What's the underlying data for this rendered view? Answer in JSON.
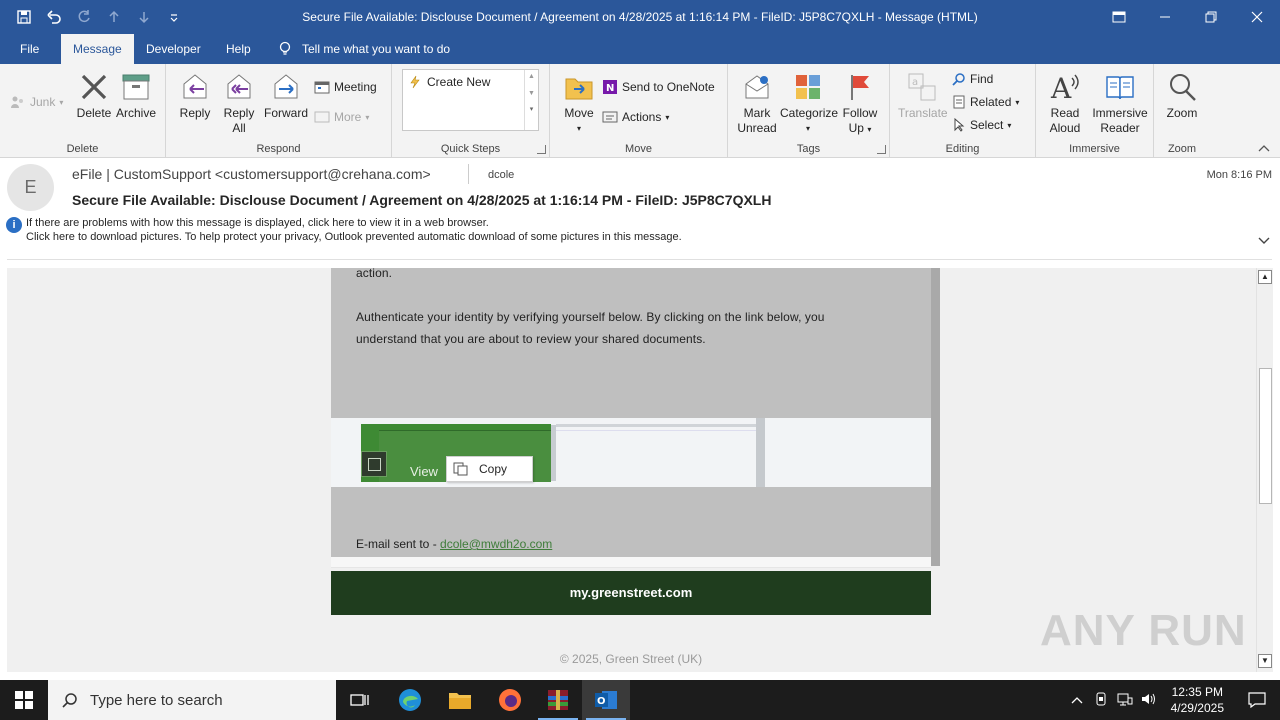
{
  "window": {
    "title": "Secure File Available: Disclouse Document / Agreement on 4/28/2025 at 1:16:14 PM - FileID: J5P8C7QXLH  -  Message (HTML)"
  },
  "tabs": [
    "File",
    "Message",
    "Developer",
    "Help"
  ],
  "tell_me": "Tell me what you want to do",
  "ribbon": {
    "delete_group": {
      "label": "Delete",
      "junk": "Junk",
      "delete": "Delete",
      "archive": "Archive"
    },
    "respond_group": {
      "label": "Respond",
      "reply": "Reply",
      "reply_all_1": "Reply",
      "reply_all_2": "All",
      "forward": "Forward",
      "meeting": "Meeting",
      "more": "More"
    },
    "quick_steps": {
      "label": "Quick Steps",
      "create_new": "Create New"
    },
    "move_group": {
      "label": "Move",
      "move": "Move",
      "send_onenote": "Send to OneNote",
      "actions": "Actions"
    },
    "tags_group": {
      "label": "Tags",
      "mark_unread_1": "Mark",
      "mark_unread_2": "Unread",
      "categorize": "Categorize",
      "follow_up_1": "Follow",
      "follow_up_2": "Up"
    },
    "editing_group": {
      "label": "Editing",
      "translate": "Translate",
      "find": "Find",
      "related": "Related",
      "select": "Select"
    },
    "immersive_group": {
      "label": "Immersive",
      "read_aloud_1": "Read",
      "read_aloud_2": "Aloud",
      "immersive_reader_1": "Immersive",
      "immersive_reader_2": "Reader"
    },
    "zoom_group": {
      "label": "Zoom",
      "zoom": "Zoom"
    }
  },
  "message": {
    "avatar_letter": "E",
    "from": "eFile | CustomSupport <customersupport@crehana.com>",
    "to": "dcole",
    "date": "Mon 8:16 PM",
    "subject": "Secure File Available: Disclouse Document / Agreement on 4/28/2025 at 1:16:14 PM - FileID: J5P8C7QXLH",
    "info_line1": "If there are problems with how this message is displayed, click here to view it in a web browser.",
    "info_line2": "Click here to download pictures. To help protect your privacy, Outlook prevented automatic download of some pictures in this message."
  },
  "body": {
    "action_text": "action.",
    "auth_text_1": "Authenticate your identity by verifying yourself below. By clicking on the link below, you",
    "auth_text_2": "understand that you are about to review your shared documents.",
    "view_button": "View",
    "context_copy": "Copy",
    "email_sent_prefix": "E-mail sent to - ",
    "email_sent_link": "dcole@mwdh2o.com",
    "footer_domain": "my.greenstreet.com",
    "copyright": "© 2025, Green Street (UK)"
  },
  "watermark": "ANY RUN",
  "taskbar": {
    "search_placeholder": "Type here to search",
    "time": "12:35 PM",
    "date": "4/29/2025"
  }
}
